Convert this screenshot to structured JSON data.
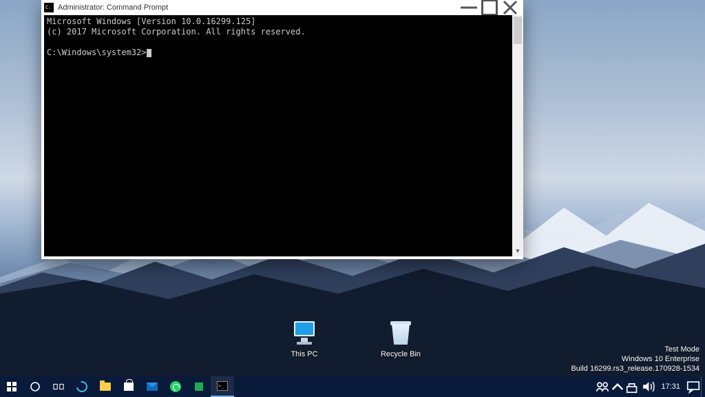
{
  "window": {
    "title": "Administrator: Command Prompt",
    "console": {
      "line1": "Microsoft Windows [Version 10.0.16299.125]",
      "line2": "(c) 2017 Microsoft Corporation. All rights reserved.",
      "blank": "",
      "prompt": "C:\\Windows\\system32>"
    }
  },
  "desktop_icons": {
    "this_pc": "This PC",
    "recycle_bin": "Recycle Bin"
  },
  "watermark": {
    "l1": "Test Mode",
    "l2": "Windows 10 Enterprise",
    "l3": "Build 16299.rs3_release.170928-1534"
  },
  "taskbar": {
    "clock": "17:31"
  }
}
